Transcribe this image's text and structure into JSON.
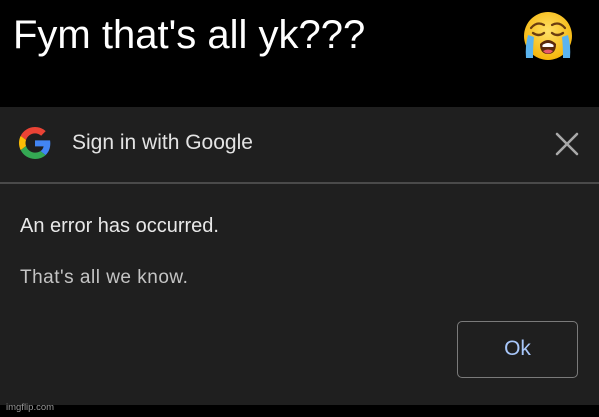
{
  "meme": {
    "caption": "Fym that's all yk???",
    "emoji": "loudly-crying-face-icon"
  },
  "dialog": {
    "logo": "google-g-logo-icon",
    "title": "Sign in with Google",
    "close_icon": "close-x-icon",
    "error_heading": "An error has occurred.",
    "error_message": "That's all we know.",
    "ok_label": "Ok"
  },
  "watermark": "imgflip.com",
  "colors": {
    "caption_background": "#000000",
    "caption_text": "#ffffff",
    "dialog_background": "#1f1f1f",
    "dialog_text": "#e3e3e3",
    "ok_text": "#a8c7fa",
    "ok_border": "#7a7a7a"
  }
}
